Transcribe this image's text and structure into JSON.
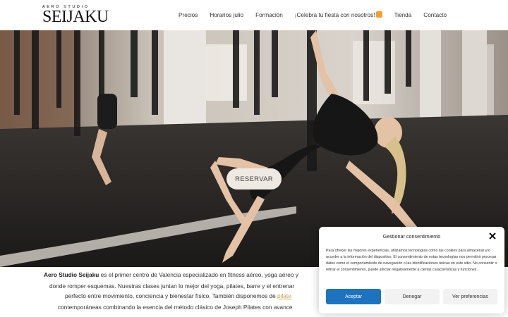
{
  "brand": {
    "top": "AERO STUDIO",
    "main": "SEIJAKU"
  },
  "nav": {
    "items": [
      {
        "label": "Precios"
      },
      {
        "label": "Horarios julio"
      },
      {
        "label": "Formación"
      },
      {
        "label": "¡Celebra tu fiesta con nosotros!"
      },
      {
        "label": "Tienda"
      },
      {
        "label": "Contacto"
      }
    ]
  },
  "hero": {
    "cta_label": "RESERVAR"
  },
  "intro": {
    "line1_bold": "Aero Studio Seijaku",
    "line1_rest": " es el primer centro de Valencia especializado en fitness aéreo, yoga aéreo y",
    "line2": "donde romper esquemas. Nuestras clases juntan lo mejor del yoga, pilates, barre y el entrenar",
    "line3_pre": "perfecto entre movimiento, conciencia y bienestar físico. También disponemos de ",
    "line3_link": "pilate",
    "line4": "contemporáneas combinando la esencia del método clásico de Joseph Pilates con avance"
  },
  "cookie": {
    "title": "Gestionar consentimiento",
    "text": "Para ofrecer las mejores experiencias, utilizamos tecnologías como las cookies para almacenar y/o acceder a la información del dispositivo. El consentimiento de estas tecnologías nos permitirá procesar datos como el comportamiento de navegación o las identificaciones únicas en este sitio. No consentir o retirar el consentimiento, puede afectar negativamente a ciertas características y funciones.",
    "accept_label": "Aceptar",
    "deny_label": "Denegar",
    "prefs_label": "Ver preferencias"
  },
  "colors": {
    "accept": "#1e73be",
    "link": "#c8a04a",
    "button_bg": "#efe9e4"
  }
}
